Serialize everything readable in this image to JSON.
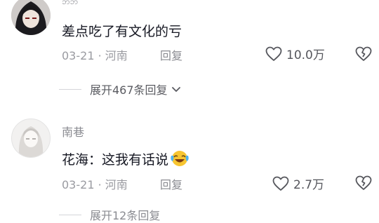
{
  "comments": [
    {
      "username": "ဘဘ",
      "content": "差点吃了有文化的亏",
      "date": "03-21",
      "location": "河南",
      "reply_label": "回复",
      "likes": "10.0万"
    },
    {
      "username": "南巷",
      "content": "花海：这我有话说",
      "date": "03-21",
      "location": "河南",
      "reply_label": "回复",
      "likes": "2.7万"
    }
  ],
  "expand_replies": "展开467条回复",
  "expand_replies_2": "展开12条回复",
  "separator": " · ",
  "colors": {
    "text": "#161823",
    "meta": "#9a9ba1"
  }
}
